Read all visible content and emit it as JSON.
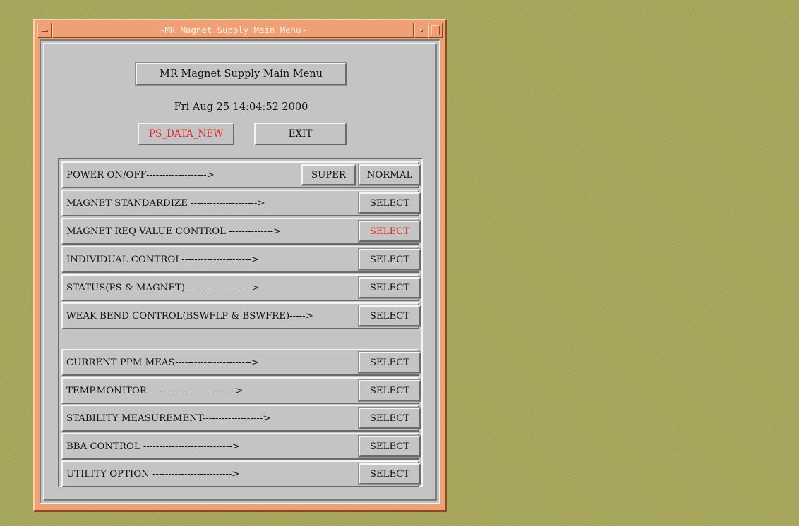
{
  "window": {
    "title": "~MR Magnet Supply Main Menu~"
  },
  "header": {
    "title": "MR Magnet Supply Main Menu",
    "datetime": "Fri Aug 25 14:04:52 2000"
  },
  "top_buttons": {
    "ps_data": "PS_DATA_NEW",
    "exit": "EXIT"
  },
  "power_row": {
    "label": "POWER ON/OFF------------------->",
    "super": "SUPER",
    "normal": "NORMAL"
  },
  "rows": [
    {
      "label": "MAGNET STANDARDIZE --------------------->",
      "button": "SELECT"
    },
    {
      "label": "MAGNET REQ VALUE CONTROL -------------->",
      "button": "SELECT"
    },
    {
      "label": "INDIVIDUAL CONTROL---------------------->",
      "button": "SELECT"
    },
    {
      "label": "STATUS(PS & MAGNET)--------------------->",
      "button": "SELECT"
    },
    {
      "label": "WEAK BEND CONTROL(BSWFLP & BSWFRE)----->",
      "button": "SELECT"
    },
    {
      "label": "CURRENT PPM MEAS------------------------>",
      "button": "SELECT"
    },
    {
      "label": "TEMP.MONITOR --------------------------->",
      "button": "SELECT"
    },
    {
      "label": "STABILITY MEASUREMENT------------------->",
      "button": "SELECT"
    },
    {
      "label": "BBA CONTROL ---------------------------->",
      "button": "SELECT"
    },
    {
      "label": "UTILITY OPTION ------------------------->",
      "button": "SELECT"
    }
  ],
  "colors": {
    "desktop": "#a7a65a",
    "window_frame": "#f0a075",
    "panel": "#c4c4c4",
    "highlight_text": "#e52424"
  }
}
